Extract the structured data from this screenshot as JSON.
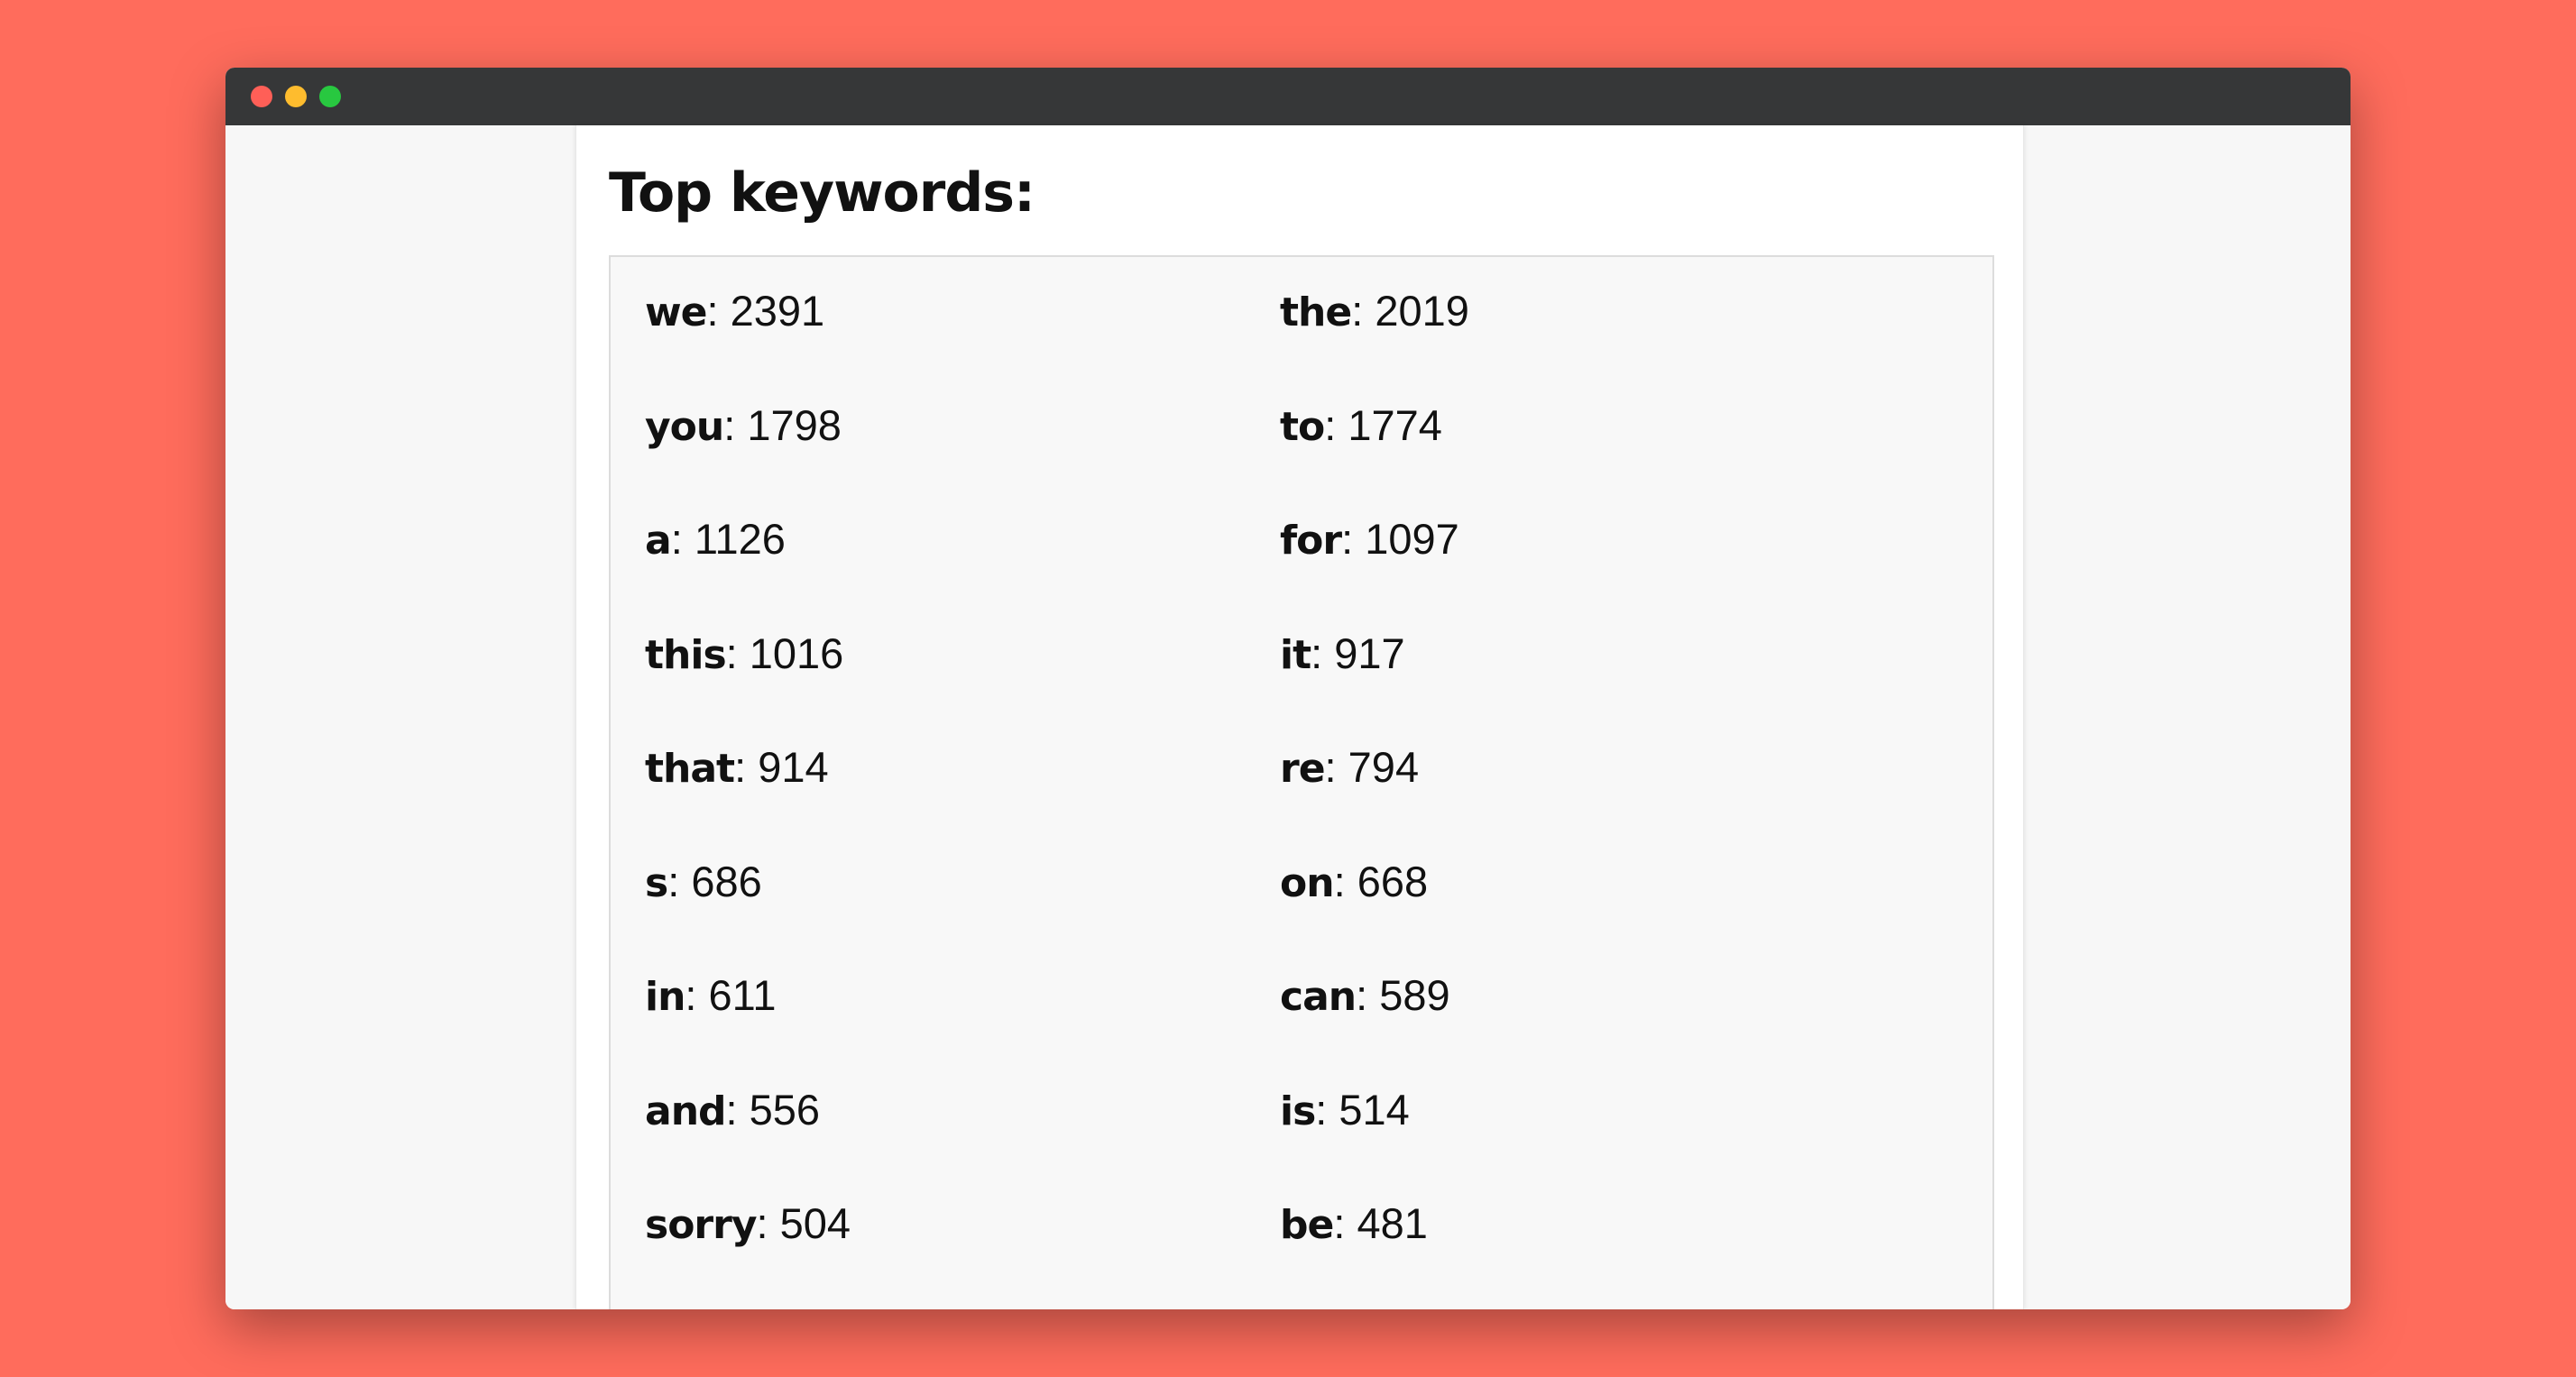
{
  "window": {
    "controls": [
      "close",
      "minimize",
      "maximize"
    ],
    "colors": {
      "background": "#ff6c5c",
      "titlebar": "#363738",
      "close": "#ff5f57",
      "minimize": "#febc2e",
      "maximize": "#28c840"
    }
  },
  "page": {
    "title": "Top keywords:"
  },
  "keywords": [
    {
      "word": "we",
      "sep": ": ",
      "count": "2391"
    },
    {
      "word": "the",
      "sep": ": ",
      "count": "2019"
    },
    {
      "word": "you",
      "sep": ": ",
      "count": "1798"
    },
    {
      "word": "to",
      "sep": ": ",
      "count": "1774"
    },
    {
      "word": "a",
      "sep": ": ",
      "count": "1126"
    },
    {
      "word": "for",
      "sep": ": ",
      "count": "1097"
    },
    {
      "word": "this",
      "sep": ": ",
      "count": "1016"
    },
    {
      "word": "it",
      "sep": ": ",
      "count": "917"
    },
    {
      "word": "that",
      "sep": ": ",
      "count": "914"
    },
    {
      "word": "re",
      "sep": ": ",
      "count": "794"
    },
    {
      "word": "s",
      "sep": ": ",
      "count": "686"
    },
    {
      "word": "on",
      "sep": ": ",
      "count": "668"
    },
    {
      "word": "in",
      "sep": ": ",
      "count": "611"
    },
    {
      "word": "can",
      "sep": ": ",
      "count": "589"
    },
    {
      "word": "and",
      "sep": ": ",
      "count": "556"
    },
    {
      "word": "is",
      "sep": ": ",
      "count": "514"
    },
    {
      "word": "sorry",
      "sep": ": ",
      "count": "504"
    },
    {
      "word": "be",
      "sep": ": ",
      "count": "481"
    }
  ]
}
